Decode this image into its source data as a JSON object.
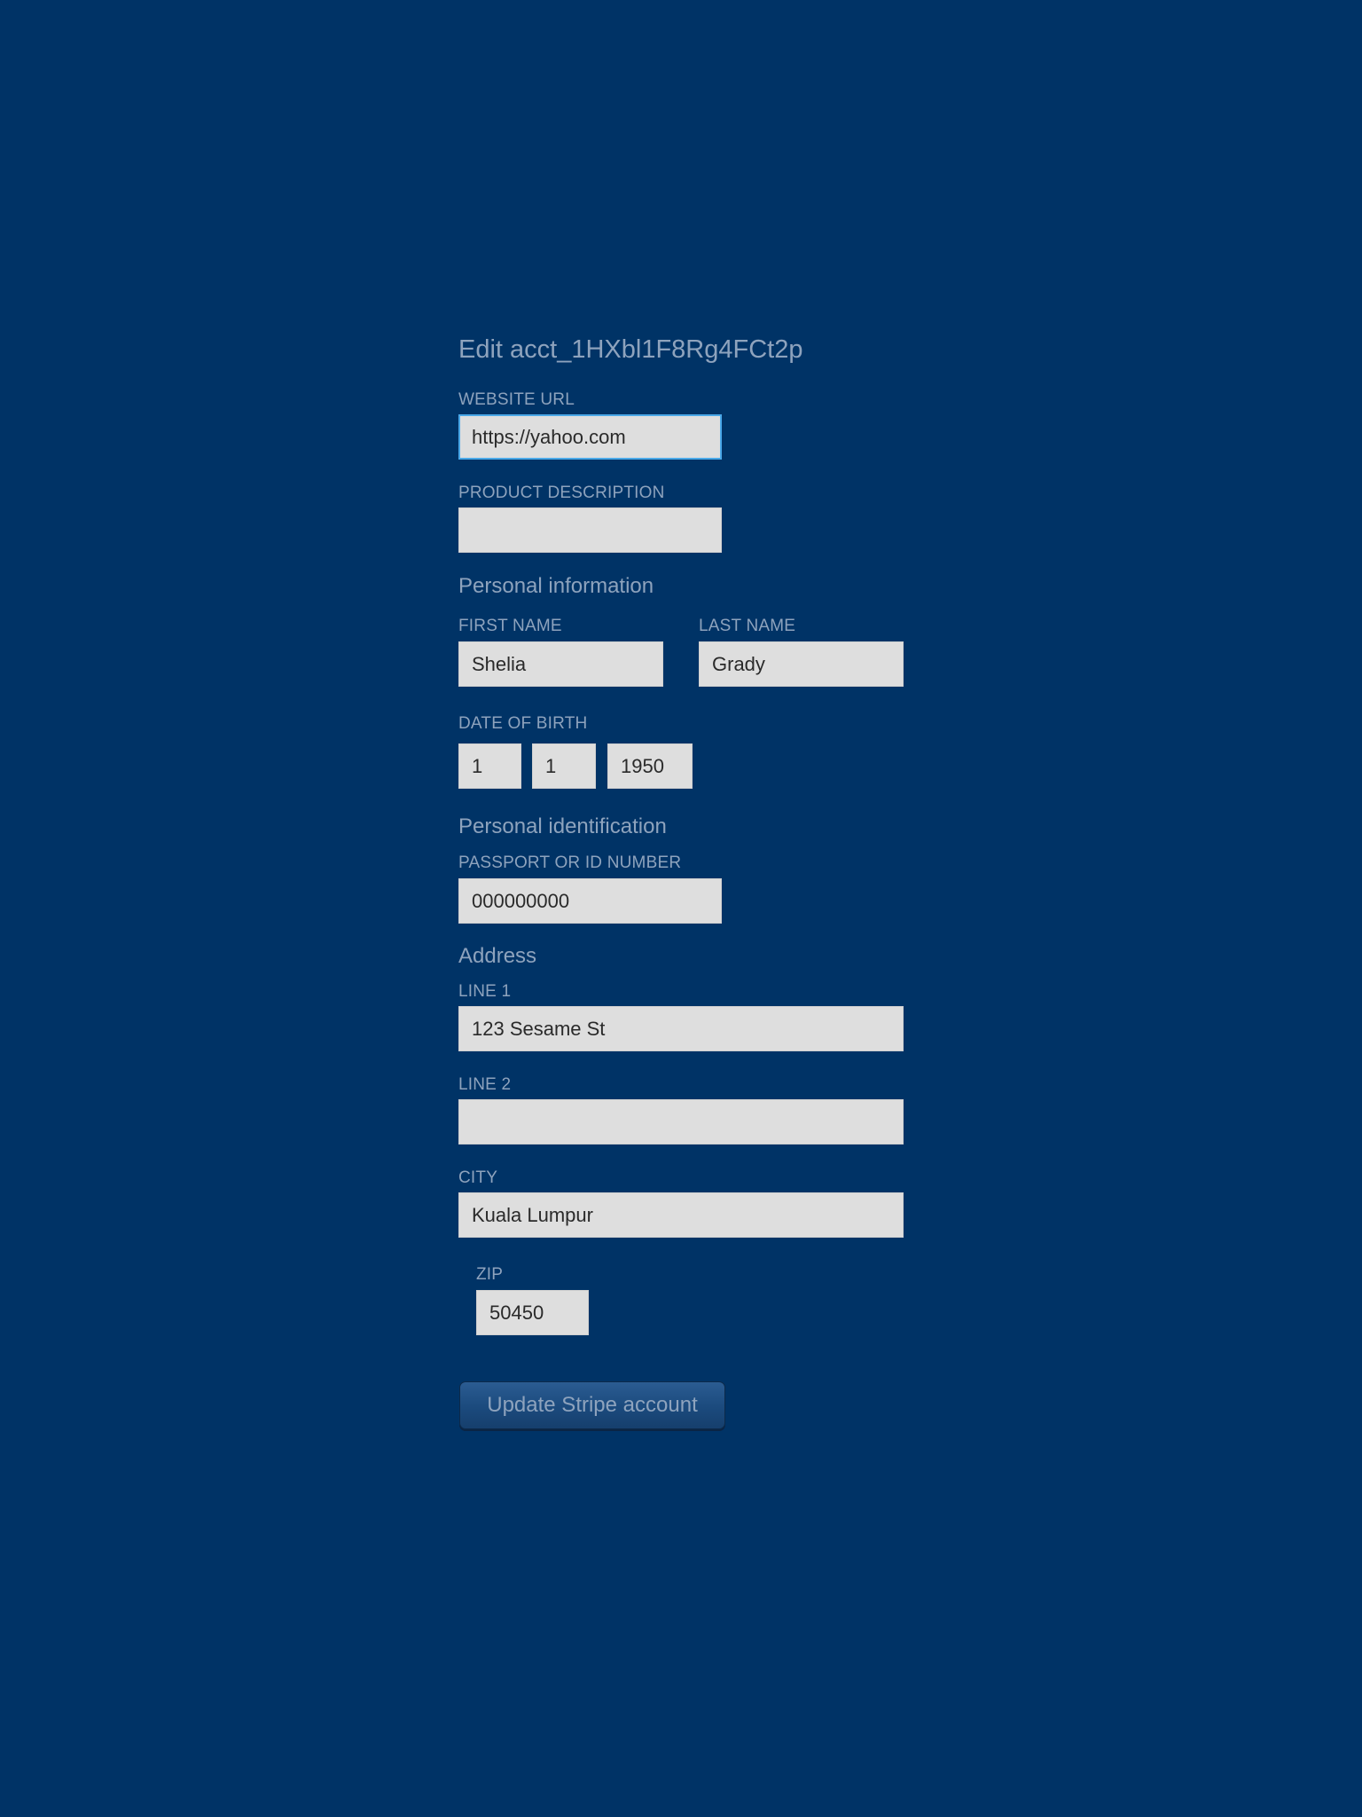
{
  "page": {
    "title": "Edit acct_1HXbl1F8Rg4FCt2p"
  },
  "website": {
    "label": "WEBSITE URL",
    "value": "https://yahoo.com"
  },
  "product": {
    "label": "PRODUCT DESCRIPTION",
    "value": ""
  },
  "personal": {
    "heading": "Personal information",
    "first_name_label": "FIRST NAME",
    "first_name": "Shelia",
    "last_name_label": "LAST NAME",
    "last_name": "Grady",
    "dob_label": "DATE OF BIRTH",
    "dob_day": "1",
    "dob_month": "1",
    "dob_year": "1950"
  },
  "identification": {
    "heading": "Personal identification",
    "id_label": "PASSPORT OR ID NUMBER",
    "id_value": "000000000"
  },
  "address": {
    "heading": "Address",
    "line1_label": "LINE 1",
    "line1": "123 Sesame St",
    "line2_label": "LINE 2",
    "line2": "",
    "city_label": "CITY",
    "city": "Kuala Lumpur",
    "zip_label": "ZIP",
    "zip": "50450"
  },
  "actions": {
    "submit_label": "Update Stripe account"
  },
  "colors": {
    "background": "#003366",
    "label_text": "#8ea3bd",
    "input_bg": "#dedede",
    "focus_border": "#4aa8e8"
  }
}
